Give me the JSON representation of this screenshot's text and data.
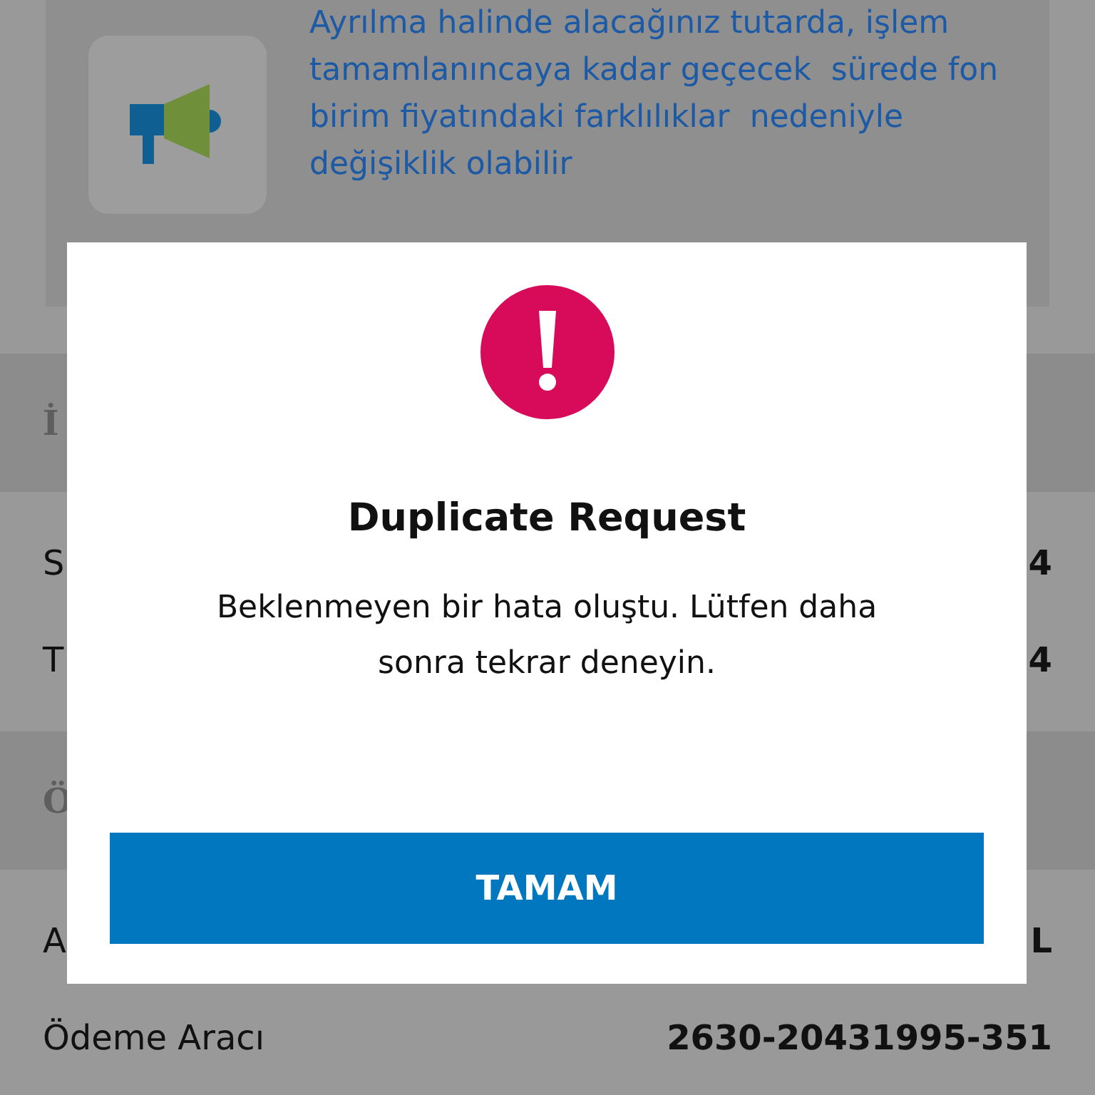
{
  "notice": {
    "text": "Ayrılma halinde alacağınız tutarda, işlem tamamlanıncaya kadar geçecek  sürede fon birim fiyatındaki farklılıklar  nedeniyle değişiklik olabilir"
  },
  "sections": [
    {
      "title": "İ",
      "rows": [
        {
          "label": "S",
          "value": "4"
        },
        {
          "label": "T",
          "value": "4"
        }
      ]
    },
    {
      "title": "Ö",
      "rows": [
        {
          "label": "A",
          "value": "L"
        },
        {
          "label": "Ödeme Aracı",
          "value": "2630-20431995-351"
        }
      ]
    }
  ],
  "dialog": {
    "title": "Duplicate Request",
    "message": "Beklenmeyen bir hata oluştu. Lütfen daha sonra tekrar deneyin.",
    "button": "TAMAM"
  }
}
